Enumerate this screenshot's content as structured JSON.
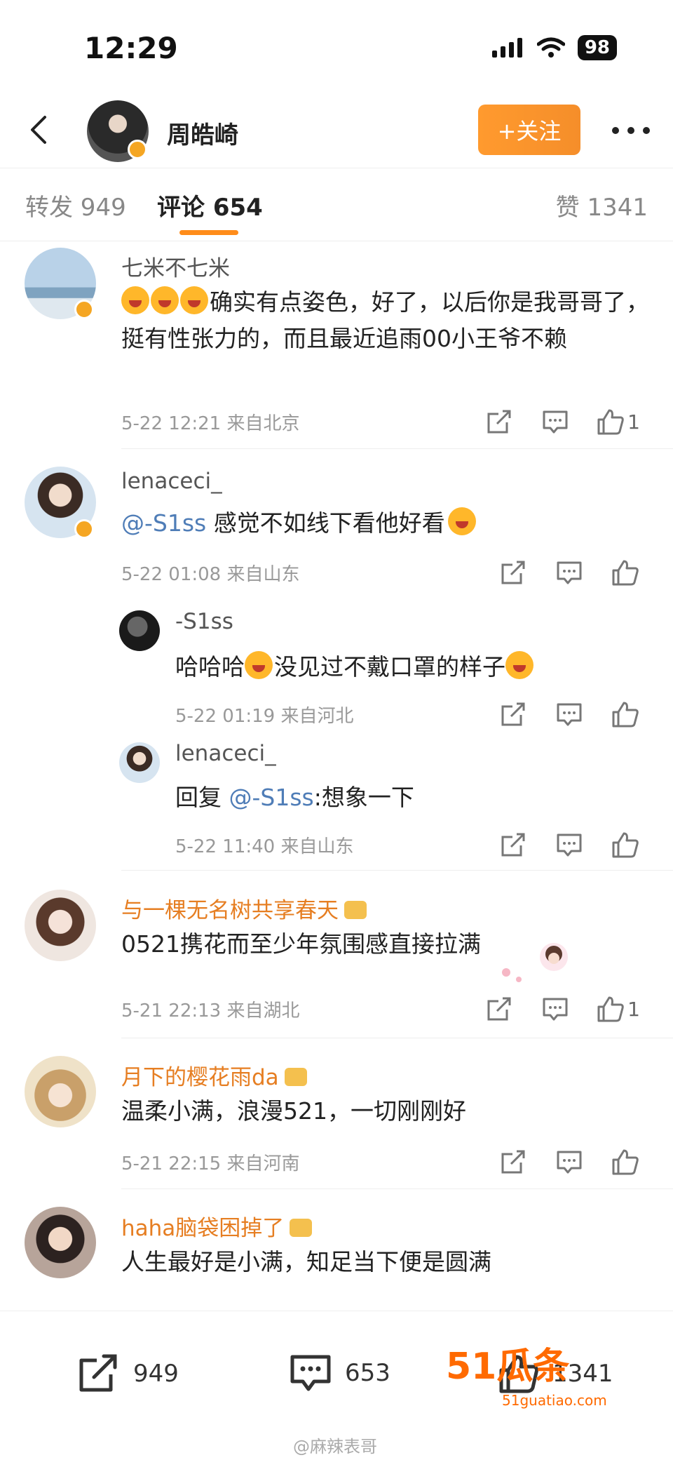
{
  "status_bar": {
    "time": "12:29",
    "battery": "98"
  },
  "header": {
    "user_name": "周皓崎",
    "follow_label": "+关注"
  },
  "tabs": {
    "reposts": "转发 949",
    "comments": "评论 654",
    "likes": "赞 1341"
  },
  "comments": [
    {
      "name": "七米不七米",
      "text": "确实有点姿色，好了，以后你是我哥哥了，挺有性张力的，而且最近追雨00小王爷不赖",
      "emoji_count": 3,
      "meta": "5-22 12:21 来自北京",
      "likes": "1"
    },
    {
      "name": "lenaceci_",
      "mention": "@-S1ss",
      "text": " 感觉不如线下看他好看",
      "meta": "5-22 01:08 来自山东",
      "likes": ""
    },
    {
      "name": "与一棵无名树共享春天",
      "text": "0521携花而至少年氛围感直接拉满",
      "meta": "5-21 22:13 来自湖北",
      "likes": "1"
    },
    {
      "name": "月下的樱花雨da",
      "text": "温柔小满，浪漫521，一切刚刚好",
      "meta": "5-21 22:15 来自河南",
      "likes": ""
    },
    {
      "name": "haha脑袋困掉了",
      "text": "人生最好是小满，知足当下便是圆满",
      "meta": "",
      "likes": ""
    }
  ],
  "replies": [
    {
      "name": "-S1ss",
      "text_a": "哈哈哈",
      "text_b": "没见过不戴口罩的样子",
      "meta": "5-22 01:19 来自河北"
    },
    {
      "name": "lenaceci_",
      "prefix": "回复 ",
      "mention": "@-S1ss",
      "text": ":想象一下",
      "meta": "5-22 11:40 来自山东"
    }
  ],
  "bottom_bar": {
    "reposts": "949",
    "comments": "653",
    "likes": "1341"
  },
  "watermark": {
    "logo": "51瓜条",
    "site": "51guatiao.com",
    "author": "@麻辣表哥"
  },
  "colors": {
    "accent": "#ff8c1a",
    "mention": "#4f7db7",
    "vip_name": "#e67e22"
  }
}
